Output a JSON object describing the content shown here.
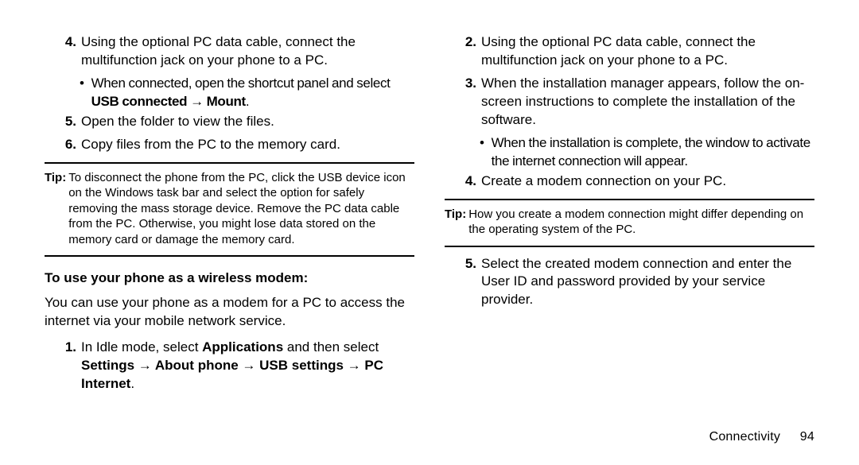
{
  "left": {
    "step4_a": "Using the optional PC data cable, connect the multifunction jack on your phone to a PC.",
    "bullet_usb_a": "When connected, open the shortcut panel and select ",
    "bullet_usb_b": "USB connected",
    "bullet_usb_arrow": " → ",
    "bullet_usb_c": "Mount",
    "bullet_usb_d": ".",
    "step5": "Open the folder to view the files.",
    "step6": "Copy files from the PC to the memory card.",
    "tip_label": "Tip:",
    "tip_body": "To disconnect the phone from the PC, click the USB device icon on the Windows task bar and select the option for safely removing the mass storage device. Remove the PC data cable from the PC. Otherwise, you might lose data stored on the memory card or damage the memory card.",
    "sect_head": "To use your phone as a wireless modem:",
    "sect_para": "You can use your phone as a modem for a PC to access the internet via your mobile network service.",
    "wm1_a": "In Idle mode, select ",
    "wm1_b": "Applications",
    "wm1_c": " and then select ",
    "wm1_path": "Settings → About phone → USB settings → PC Internet",
    "wm1_d": "."
  },
  "right": {
    "step2": "Using the optional PC data cable, connect the multifunction jack on your phone to a PC.",
    "step3": "When the installation manager appears, follow the on-screen instructions to complete the installation of the software.",
    "bullet3": "When the installation is complete, the window to activate the internet connection will appear.",
    "step4": "Create a modem connection on your PC.",
    "tip_label": "Tip:",
    "tip_body": "How you create a modem connection might differ depending on the operating system of the PC.",
    "step5": "Select the created modem connection and enter the User ID and password provided by your service provider."
  },
  "numbers": {
    "n1": "1.",
    "n2": "2.",
    "n3": "3.",
    "n4": "4.",
    "n5": "5.",
    "n6": "6."
  },
  "footer": {
    "section": "Connectivity",
    "page": "94"
  }
}
